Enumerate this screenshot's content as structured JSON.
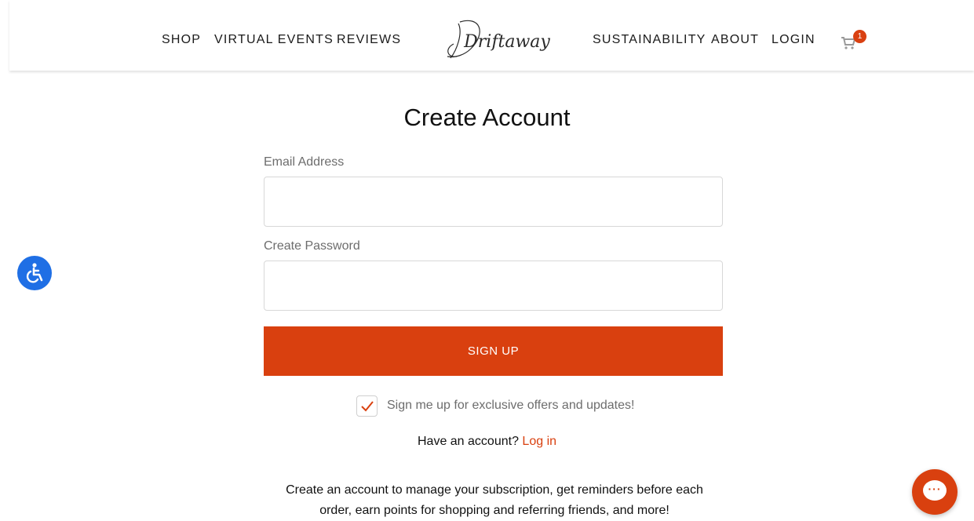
{
  "header": {
    "nav_left": [
      "SHOP",
      "VIRTUAL EVENTS",
      "REVIEWS"
    ],
    "logo_text": "Driftaway",
    "nav_right": [
      "SUSTAINABILITY",
      "ABOUT",
      "LOGIN"
    ],
    "cart_count": "1"
  },
  "form": {
    "title": "Create Account",
    "email_label": "Email Address",
    "email_value": "",
    "password_label": "Create Password",
    "password_value": "",
    "signup_label": "SIGN UP",
    "newsletter_checked": true,
    "newsletter_label": "Sign me up for exclusive offers and updates!",
    "have_account_text": "Have an account?",
    "login_link": "Log in",
    "info_text": "Create an account to manage your subscription, get reminders before each order, earn points for shopping and referring friends, and more!"
  },
  "colors": {
    "accent": "#d9400f",
    "accessibility_button": "#1f6fe5"
  },
  "icons": {
    "cart": "cart-icon",
    "accessibility": "accessibility-icon",
    "chat": "chat-icon",
    "check": "check-icon"
  }
}
